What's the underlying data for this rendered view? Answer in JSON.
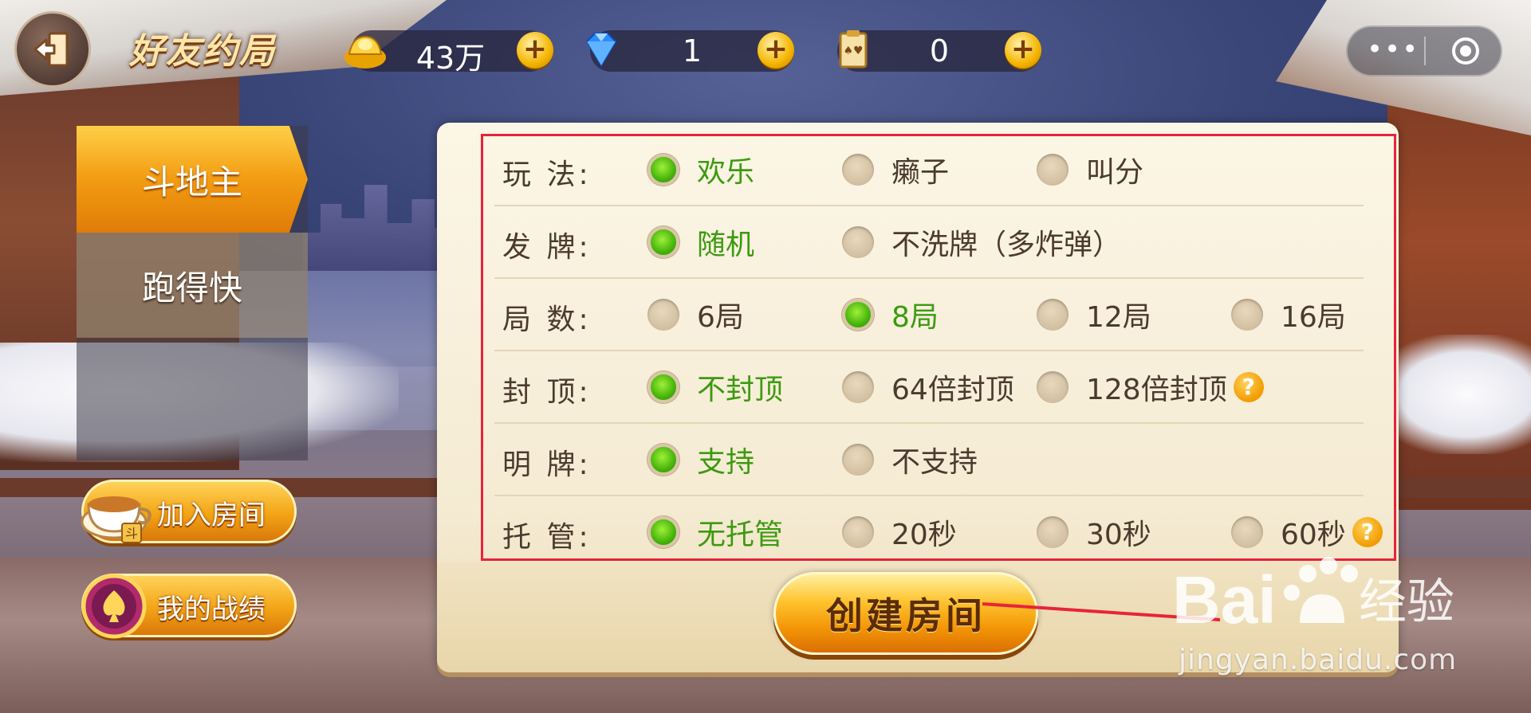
{
  "header": {
    "title": "好友约局",
    "resources": [
      {
        "icon": "gold-ingot-icon",
        "value": "43万"
      },
      {
        "icon": "diamond-icon",
        "value": "1"
      },
      {
        "icon": "room-card-icon",
        "value": "0"
      }
    ],
    "plus_label": "+"
  },
  "sidebar": {
    "items": [
      {
        "label": "斗地主",
        "active": true
      },
      {
        "label": "跑得快",
        "active": false
      }
    ],
    "buttons": [
      {
        "label": "加入房间",
        "icon": "teacup-icon"
      },
      {
        "label": "我的战绩",
        "icon": "spade-medal-icon"
      }
    ]
  },
  "settings": {
    "rows": [
      {
        "label": "玩  法:",
        "options": [
          {
            "text": "欢乐",
            "selected": true
          },
          {
            "text": "癞子",
            "selected": false
          },
          {
            "text": "叫分",
            "selected": false
          }
        ]
      },
      {
        "label": "发  牌:",
        "options": [
          {
            "text": "随机",
            "selected": true
          },
          {
            "text": "不洗牌（多炸弹）",
            "selected": false
          }
        ]
      },
      {
        "label": "局  数:",
        "options": [
          {
            "text": "6局",
            "selected": false
          },
          {
            "text": "8局",
            "selected": true
          },
          {
            "text": "12局",
            "selected": false
          },
          {
            "text": "16局",
            "selected": false
          }
        ]
      },
      {
        "label": "封  顶:",
        "options": [
          {
            "text": "不封顶",
            "selected": true
          },
          {
            "text": "64倍封顶",
            "selected": false
          },
          {
            "text": "128倍封顶",
            "selected": false,
            "help": "?"
          }
        ]
      },
      {
        "label": "明  牌:",
        "options": [
          {
            "text": "支持",
            "selected": true
          },
          {
            "text": "不支持",
            "selected": false
          }
        ]
      },
      {
        "label": "托  管:",
        "options": [
          {
            "text": "无托管",
            "selected": true
          },
          {
            "text": "20秒",
            "selected": false
          },
          {
            "text": "30秒",
            "selected": false
          },
          {
            "text": "60秒",
            "selected": false,
            "help": "?"
          }
        ]
      }
    ],
    "create_button": "创建房间"
  },
  "watermark": {
    "brand": "Bai 经验",
    "url": "jingyan.baidu.com"
  },
  "colors": {
    "selected_text": "#3c9a10",
    "annotation": "#e8233a",
    "accent_gold": "#f39406"
  }
}
